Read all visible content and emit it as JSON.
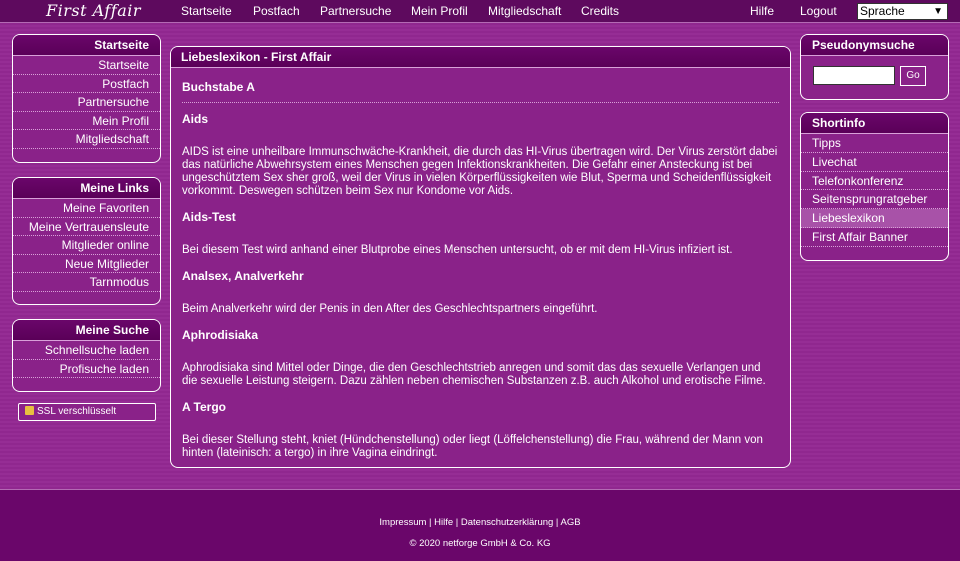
{
  "topnav": {
    "logo": "First Affair",
    "items": [
      "Startseite",
      "Postfach",
      "Partnersuche",
      "Mein Profil",
      "Mitgliedschaft",
      "Credits"
    ],
    "help": "Hilfe",
    "logout": "Logout",
    "language": "Sprache"
  },
  "left": {
    "box1": {
      "title": "Startseite",
      "items": [
        "Startseite",
        "Postfach",
        "Partnersuche",
        "Mein Profil",
        "Mitgliedschaft"
      ]
    },
    "box2": {
      "title": "Meine Links",
      "items": [
        "Meine Favoriten",
        "Meine Vertrauensleute",
        "Mitglieder online",
        "Neue Mitglieder",
        "Tarnmodus"
      ]
    },
    "box3": {
      "title": "Meine Suche",
      "items": [
        "Schnellsuche laden",
        "Profisuche laden"
      ]
    },
    "ssl": "SSL verschlüsselt"
  },
  "main": {
    "title": "Liebeslexikon - First Affair",
    "letter": "Buchstabe A",
    "entries": [
      {
        "term": "Aids",
        "def": "AIDS ist eine unheilbare Immunschwäche-Krankheit, die durch das HI-Virus übertragen wird. Der Virus zerstört dabei das natürliche Abwehrsystem eines Menschen gegen Infektionskrankheiten. Die Gefahr einer Ansteckung ist bei ungeschütztem Sex sher groß, weil der Virus in vielen Körperflüssigkeiten wie Blut, Sperma und Scheidenflüssigkeit vorkommt. Deswegen schützen beim Sex nur Kondome vor Aids."
      },
      {
        "term": "Aids-Test",
        "def": "Bei diesem Test wird anhand einer Blutprobe eines Menschen untersucht, ob er mit dem HI-Virus infiziert ist."
      },
      {
        "term": "Analsex, Analverkehr",
        "def": "Beim Analverkehr wird der Penis in den After des Geschlechtspartners eingeführt."
      },
      {
        "term": "Aphrodisiaka",
        "def": "Aphrodisiaka sind Mittel oder Dinge, die den Geschlechtstrieb anregen und somit das das sexuelle Verlangen und die sexuelle Leistung steigern. Dazu zählen neben chemischen Substanzen z.B. auch Alkohol und erotische Filme."
      },
      {
        "term": "A Tergo",
        "def": "Bei dieser Stellung steht, kniet (Hündchenstellung) oder liegt (Löffelchenstellung) die Frau, während der Mann von hinten (lateinisch: a tergo) in ihre Vagina eindringt."
      }
    ]
  },
  "right": {
    "search": {
      "title": "Pseudonymsuche",
      "value": "",
      "go": "Go"
    },
    "shortinfo": {
      "title": "Shortinfo",
      "items": [
        "Tipps",
        "Livechat",
        "Telefonkonferenz",
        "Seitensprungratgeber",
        "Liebeslexikon",
        "First Affair Banner"
      ],
      "active": "Liebeslexikon"
    }
  },
  "footer": {
    "links": "Impressum | Hilfe | Datenschutzerklärung | AGB",
    "copyright": "© 2020 netforge GmbH & Co. KG"
  }
}
